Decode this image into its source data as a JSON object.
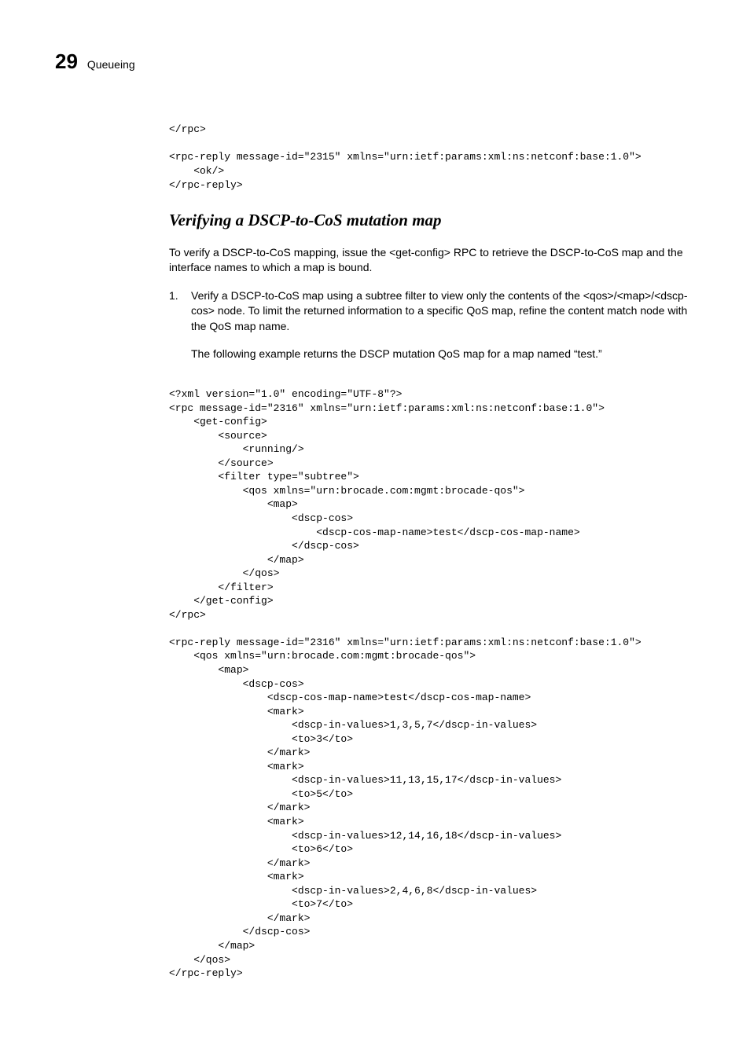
{
  "header": {
    "chapter_number": "29",
    "chapter_title": "Queueing"
  },
  "code_block_top": "</rpc>\n\n<rpc-reply message-id=\"2315\" xmlns=\"urn:ietf:params:xml:ns:netconf:base:1.0\">\n    <ok/>\n</rpc-reply>",
  "section_title": "Verifying a DSCP-to-CoS mutation map",
  "intro_paragraph": "To verify a DSCP-to-CoS mapping, issue the <get-config> RPC to retrieve the DSCP-to-CoS map and the interface names to which a map is bound.",
  "step": {
    "number": "1.",
    "para1": "Verify a DSCP-to-CoS map using a subtree filter to view only the contents of the <qos>/<map>/<dscp-cos> node. To limit the returned information to a specific QoS map, refine the content match node with the QoS map name.",
    "para2": "The following example returns the DSCP mutation QoS map for a map named “test.”"
  },
  "code_block_main": "<?xml version=\"1.0\" encoding=\"UTF-8\"?>\n<rpc message-id=\"2316\" xmlns=\"urn:ietf:params:xml:ns:netconf:base:1.0\">\n    <get-config>\n        <source>\n            <running/>\n        </source>\n        <filter type=\"subtree\">\n            <qos xmlns=\"urn:brocade.com:mgmt:brocade-qos\">\n                <map>\n                    <dscp-cos>\n                        <dscp-cos-map-name>test</dscp-cos-map-name>\n                    </dscp-cos>\n                </map>\n            </qos>\n        </filter>\n    </get-config>\n</rpc>\n\n<rpc-reply message-id=\"2316\" xmlns=\"urn:ietf:params:xml:ns:netconf:base:1.0\">\n    <qos xmlns=\"urn:brocade.com:mgmt:brocade-qos\">\n        <map>\n            <dscp-cos>\n                <dscp-cos-map-name>test</dscp-cos-map-name>\n                <mark>\n                    <dscp-in-values>1,3,5,7</dscp-in-values>\n                    <to>3</to>\n                </mark>\n                <mark>\n                    <dscp-in-values>11,13,15,17</dscp-in-values>\n                    <to>5</to>\n                </mark>\n                <mark>\n                    <dscp-in-values>12,14,16,18</dscp-in-values>\n                    <to>6</to>\n                </mark>\n                <mark>\n                    <dscp-in-values>2,4,6,8</dscp-in-values>\n                    <to>7</to>\n                </mark>\n            </dscp-cos>\n        </map>\n    </qos>\n</rpc-reply>"
}
